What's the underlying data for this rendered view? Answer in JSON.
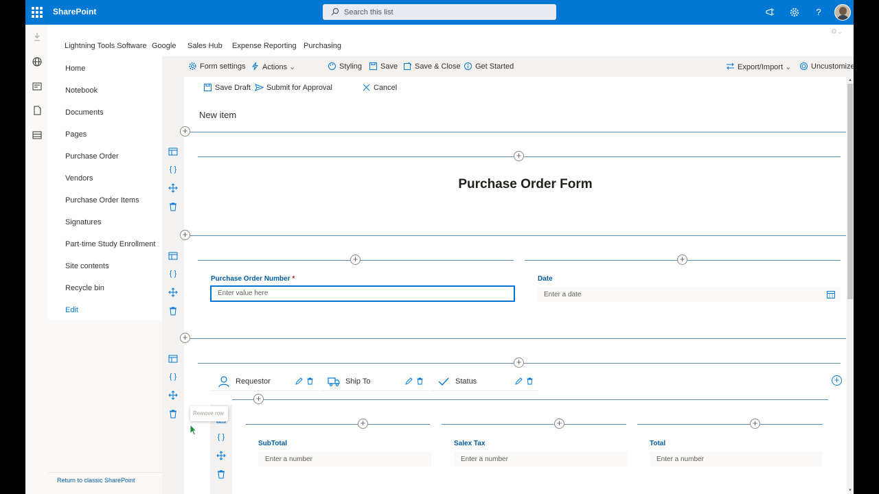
{
  "suite": {
    "brand": "SharePoint",
    "search_placeholder": "Search this list"
  },
  "hubnav": [
    "Lightning Tools Software",
    "Google",
    "Sales Hub",
    "Expense Reporting",
    "Purchasing"
  ],
  "leftnav": {
    "items": [
      "Home",
      "Notebook",
      "Documents",
      "Pages",
      "Purchase Order",
      "Vendors",
      "Purchase Order Items",
      "Signatures",
      "Part-time Study Enrollment",
      "Site contents",
      "Recycle bin"
    ],
    "edit": "Edit",
    "classic_link": "Return to classic SharePoint"
  },
  "commandbar": {
    "form_settings": "Form settings",
    "actions": "Actions",
    "styling": "Styling",
    "save": "Save",
    "save_close": "Save & Close",
    "get_started": "Get Started",
    "export_import": "Export/Import",
    "uncustomize": "Uncustomize form"
  },
  "form_toolbar": {
    "save_draft": "Save Draft",
    "submit": "Submit for Approval",
    "cancel": "Cancel"
  },
  "form": {
    "page_title": "New item",
    "heading": "Purchase Order Form",
    "po_number_label": "Purchase Order Number",
    "required_mark": "*",
    "po_number_placeholder": "Enter value here",
    "date_label": "Date",
    "date_placeholder": "Enter a date",
    "tabs": [
      "Requestor",
      "Ship To",
      "Status"
    ],
    "subtotal_label": "SubTotal",
    "salestax_label": "Salex Tax",
    "total_label": "Total",
    "number_placeholder": "Enter a number"
  },
  "tooltip": "Remove row",
  "colors": {
    "suitebar": "#0078d4",
    "accent": "#0078d4",
    "label": "#005a9e",
    "required": "#a4262c"
  }
}
